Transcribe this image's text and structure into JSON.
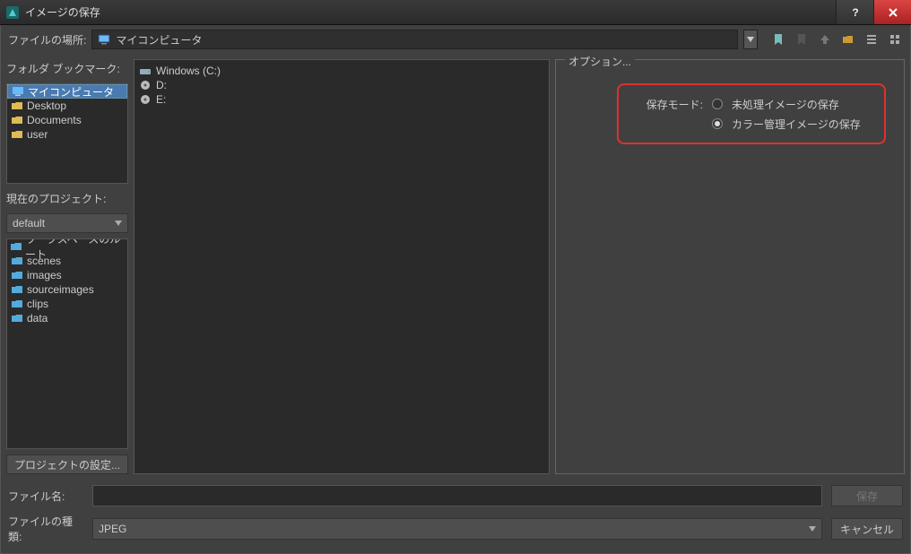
{
  "window": {
    "title": "イメージの保存"
  },
  "location": {
    "label": "ファイルの場所:",
    "value": "マイコンピュータ"
  },
  "sidebar": {
    "bookmarks_label": "フォルダ ブックマーク:",
    "bookmarks": [
      {
        "label": "マイコンピュータ",
        "icon": "computer",
        "selected": true
      },
      {
        "label": "Desktop",
        "icon": "folder"
      },
      {
        "label": "Documents",
        "icon": "folder"
      },
      {
        "label": "user",
        "icon": "folder"
      }
    ],
    "project_label": "現在のプロジェクト:",
    "project_value": "default",
    "workspace_root": "ワークスペースのルート",
    "workspace_items": [
      {
        "label": "scenes"
      },
      {
        "label": "images"
      },
      {
        "label": "sourceimages"
      },
      {
        "label": "clips"
      },
      {
        "label": "data"
      }
    ],
    "project_settings_btn": "プロジェクトの設定..."
  },
  "browser": {
    "files": [
      {
        "label": "Windows (C:)",
        "icon": "drive"
      },
      {
        "label": "D:",
        "icon": "disc"
      },
      {
        "label": "E:",
        "icon": "disc"
      }
    ]
  },
  "options": {
    "legend": "オプション...",
    "save_mode_label": "保存モード:",
    "radio_unprocessed": "未処理イメージの保存",
    "radio_color_managed": "カラー管理イメージの保存"
  },
  "bottom": {
    "filename_label": "ファイル名:",
    "filename_value": "",
    "filetype_label": "ファイルの種類:",
    "filetype_value": "JPEG",
    "save_btn": "保存",
    "cancel_btn": "キャンセル"
  }
}
